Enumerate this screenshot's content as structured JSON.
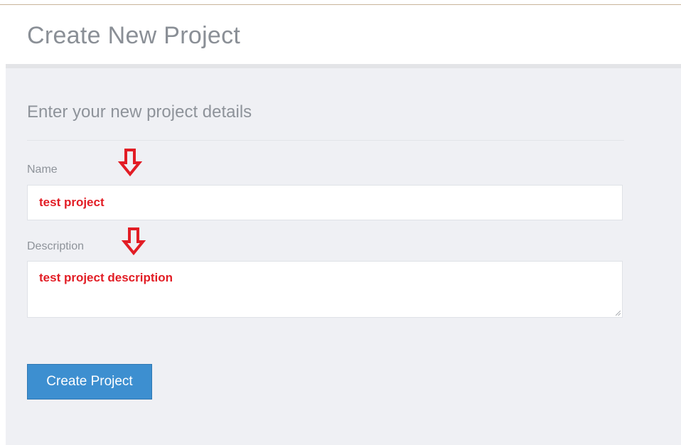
{
  "header": {
    "title": "Create New Project"
  },
  "form": {
    "section_title": "Enter your new project details",
    "name": {
      "label": "Name",
      "value": "test project"
    },
    "description": {
      "label": "Description",
      "value": "test project description"
    },
    "submit_label": "Create Project"
  },
  "annotations": {
    "arrow_color": "#e21d25",
    "arrow_icon": "down-arrow-outline-icon"
  },
  "colors": {
    "accent": "#3d8fd0",
    "panel_background": "#eff0f4",
    "annotation_text": "#e21d25"
  }
}
